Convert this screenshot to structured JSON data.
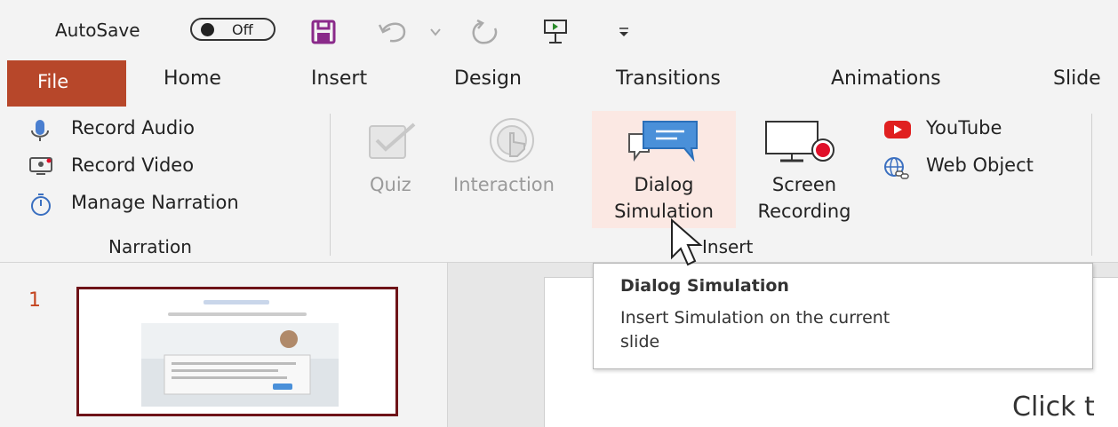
{
  "qat": {
    "autosave_label": "AutoSave",
    "autosave_state": "Off",
    "icons": [
      "save-icon",
      "undo-icon",
      "dropdown-icon",
      "redo-icon",
      "present-icon",
      "customize-icon"
    ]
  },
  "tabs": [
    "File",
    "Home",
    "Insert",
    "Design",
    "Transitions",
    "Animations",
    "Slide"
  ],
  "ribbon": {
    "narration": {
      "items": [
        "Record Audio",
        "Record Video",
        "Manage Narration"
      ],
      "group_label": "Narration"
    },
    "insert": {
      "quiz": "Quiz",
      "interaction": "Interaction",
      "dialog_line1": "Dialog",
      "dialog_line2": "Simulation",
      "screen_line1": "Screen",
      "screen_line2": "Recording",
      "youtube": "YouTube",
      "web_object": "Web Object",
      "group_label": "Insert"
    }
  },
  "slides_pane": {
    "slide_number": "1"
  },
  "tooltip": {
    "title": "Dialog Simulation",
    "description_line1": "Insert Simulation on the current",
    "description_line2": "slide"
  },
  "canvas": {
    "placeholder_text": "Click t"
  },
  "colors": {
    "file_tab": "#b7472a",
    "save_icon": "#8a2a8a",
    "dialog_icon": "#4a90d9",
    "youtube_red": "#e02020",
    "record_red": "#e0102a",
    "thumb_border": "#6e1318",
    "highlight": "#fbe8e3"
  }
}
